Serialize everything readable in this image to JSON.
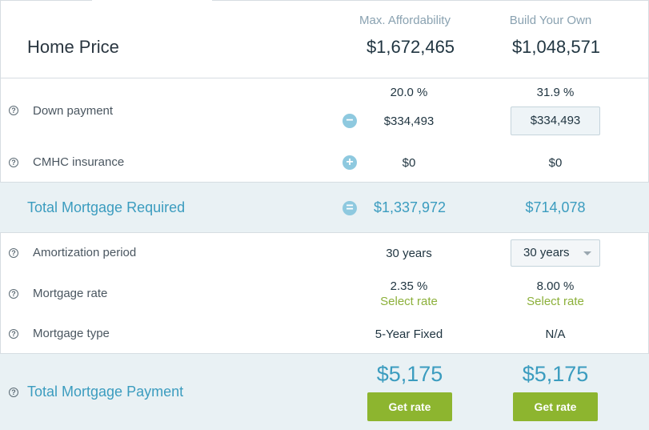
{
  "columns": {
    "max_affordability": "Max. Affordability",
    "build_your_own": "Build Your Own"
  },
  "home_price": {
    "label": "Home Price",
    "max_value": "$1,672,465",
    "build_value": "$1,048,571"
  },
  "down_payment": {
    "label": "Down payment",
    "max_percent": "20.0 %",
    "build_percent": "31.9 %",
    "max_amount": "$334,493",
    "build_amount": "$334,493",
    "sign": "−"
  },
  "cmhc": {
    "label": "CMHC insurance",
    "max_value": "$0",
    "build_value": "$0",
    "sign": "+"
  },
  "total_mortgage_required": {
    "label": "Total Mortgage Required",
    "max_value": "$1,337,972",
    "build_value": "$714,078",
    "sign": "="
  },
  "amortization": {
    "label": "Amortization period",
    "max_value": "30 years",
    "build_selected": "30 years"
  },
  "mortgage_rate": {
    "label": "Mortgage rate",
    "max_value": "2.35 %",
    "build_value": "8.00 %",
    "select_rate_label": "Select rate"
  },
  "mortgage_type": {
    "label": "Mortgage type",
    "max_value": "5-Year Fixed",
    "build_value": "N/A"
  },
  "total_mortgage_payment": {
    "label": "Total Mortgage Payment",
    "max_value": "$5,175",
    "build_value": "$5,175",
    "button_label": "Get rate"
  },
  "icons": {
    "help": "?"
  },
  "colors": {
    "accent_blue": "#3b9cbf",
    "accent_green": "#8db52f",
    "band_bg": "#e9f1f4"
  }
}
